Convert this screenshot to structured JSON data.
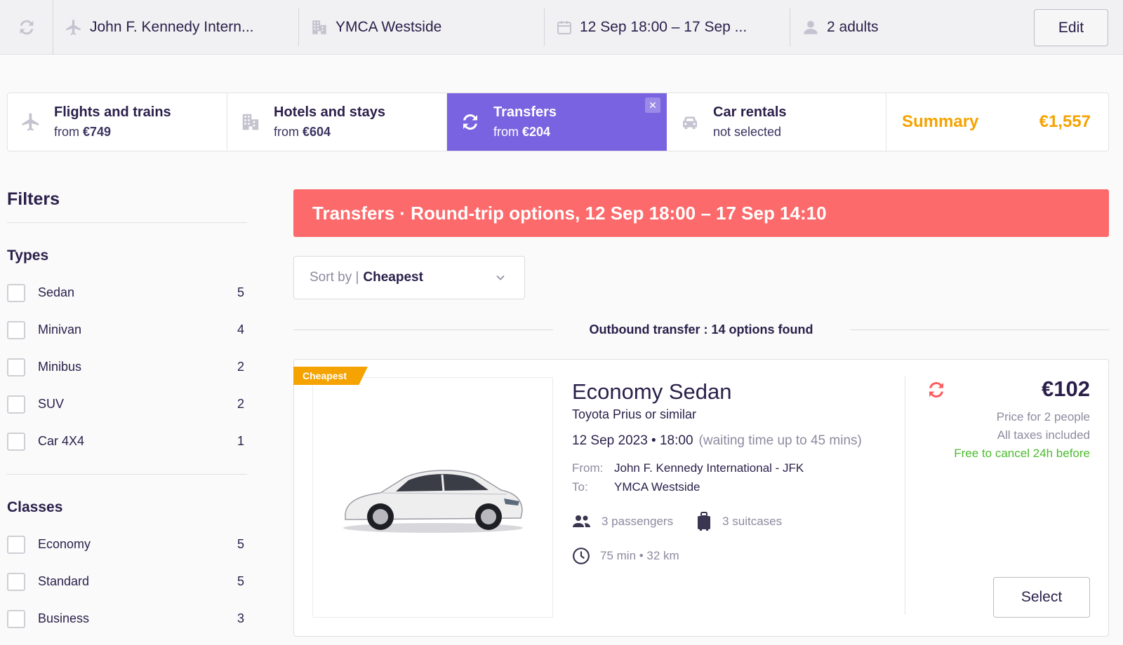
{
  "topbar": {
    "origin": "John F. Kennedy Intern...",
    "destination": "YMCA Westside",
    "dates": "12 Sep 18:00 – 17 Sep ...",
    "travelers": "2 adults",
    "edit_label": "Edit"
  },
  "tabs": [
    {
      "title": "Flights and trains",
      "prefix": "from",
      "price": "€749",
      "icon": "airplane-icon"
    },
    {
      "title": "Hotels and stays",
      "prefix": "from",
      "price": "€604",
      "icon": "building-icon"
    },
    {
      "title": "Transfers",
      "prefix": "from",
      "price": "€204",
      "icon": "transfer-icon",
      "active": true
    },
    {
      "title": "Car rentals",
      "status": "not selected",
      "icon": "car-icon"
    }
  ],
  "summary": {
    "label": "Summary",
    "total": "€1,557"
  },
  "filters": {
    "title": "Filters",
    "types_heading": "Types",
    "types": [
      {
        "label": "Sedan",
        "count": "5"
      },
      {
        "label": "Minivan",
        "count": "4"
      },
      {
        "label": "Minibus",
        "count": "2"
      },
      {
        "label": "SUV",
        "count": "2"
      },
      {
        "label": "Car 4X4",
        "count": "1"
      }
    ],
    "classes_heading": "Classes",
    "classes": [
      {
        "label": "Economy",
        "count": "5"
      },
      {
        "label": "Standard",
        "count": "5"
      },
      {
        "label": "Business",
        "count": "3"
      }
    ]
  },
  "banner": "Transfers · Round-trip options, 12 Sep 18:00 – 17 Sep 14:10",
  "sort": {
    "label": "Sort by |",
    "value": "Cheapest"
  },
  "outbound": "Outbound transfer : 14 options found",
  "result": {
    "badge": "Cheapest",
    "name": "Economy Sedan",
    "model": "Toyota Prius or similar",
    "datetime": "12 Sep 2023 • 18:00",
    "waiting": "(waiting time up to 45 mins)",
    "from_label": "From:",
    "from": "John F. Kennedy International - JFK",
    "to_label": "To:",
    "to": "YMCA Westside",
    "passengers": "3 passengers",
    "suitcases": "3 suitcases",
    "duration": "75 min • 32 km",
    "price": "€102",
    "price_note": "Price for 2 people",
    "taxes": "All taxes included",
    "cancel": "Free to cancel 24h before",
    "select_label": "Select"
  },
  "colors": {
    "accent": "#7a63e0",
    "banner": "#fd6a6b",
    "summary": "#f5a300",
    "free_cancel": "#4cbc2e"
  }
}
